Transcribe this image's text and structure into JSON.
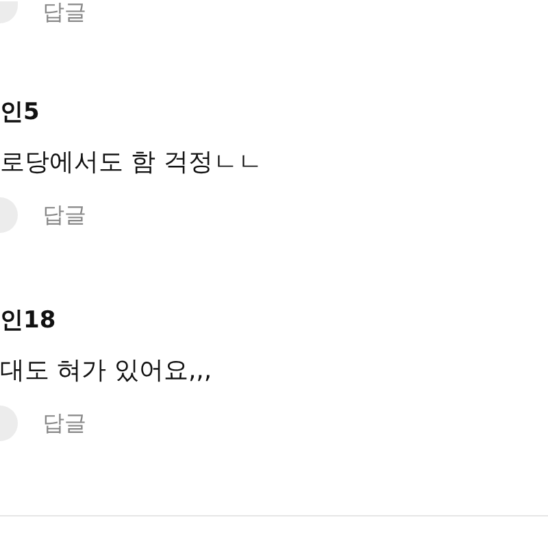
{
  "top_reply": {
    "label": "답글"
  },
  "comments": [
    {
      "author": "인5",
      "text": "로당에서도 함 걱정ㄴㄴ",
      "reply": "답글"
    },
    {
      "author": "인18",
      "text": "대도 혀가 있어요,,,",
      "reply": "답글"
    }
  ]
}
